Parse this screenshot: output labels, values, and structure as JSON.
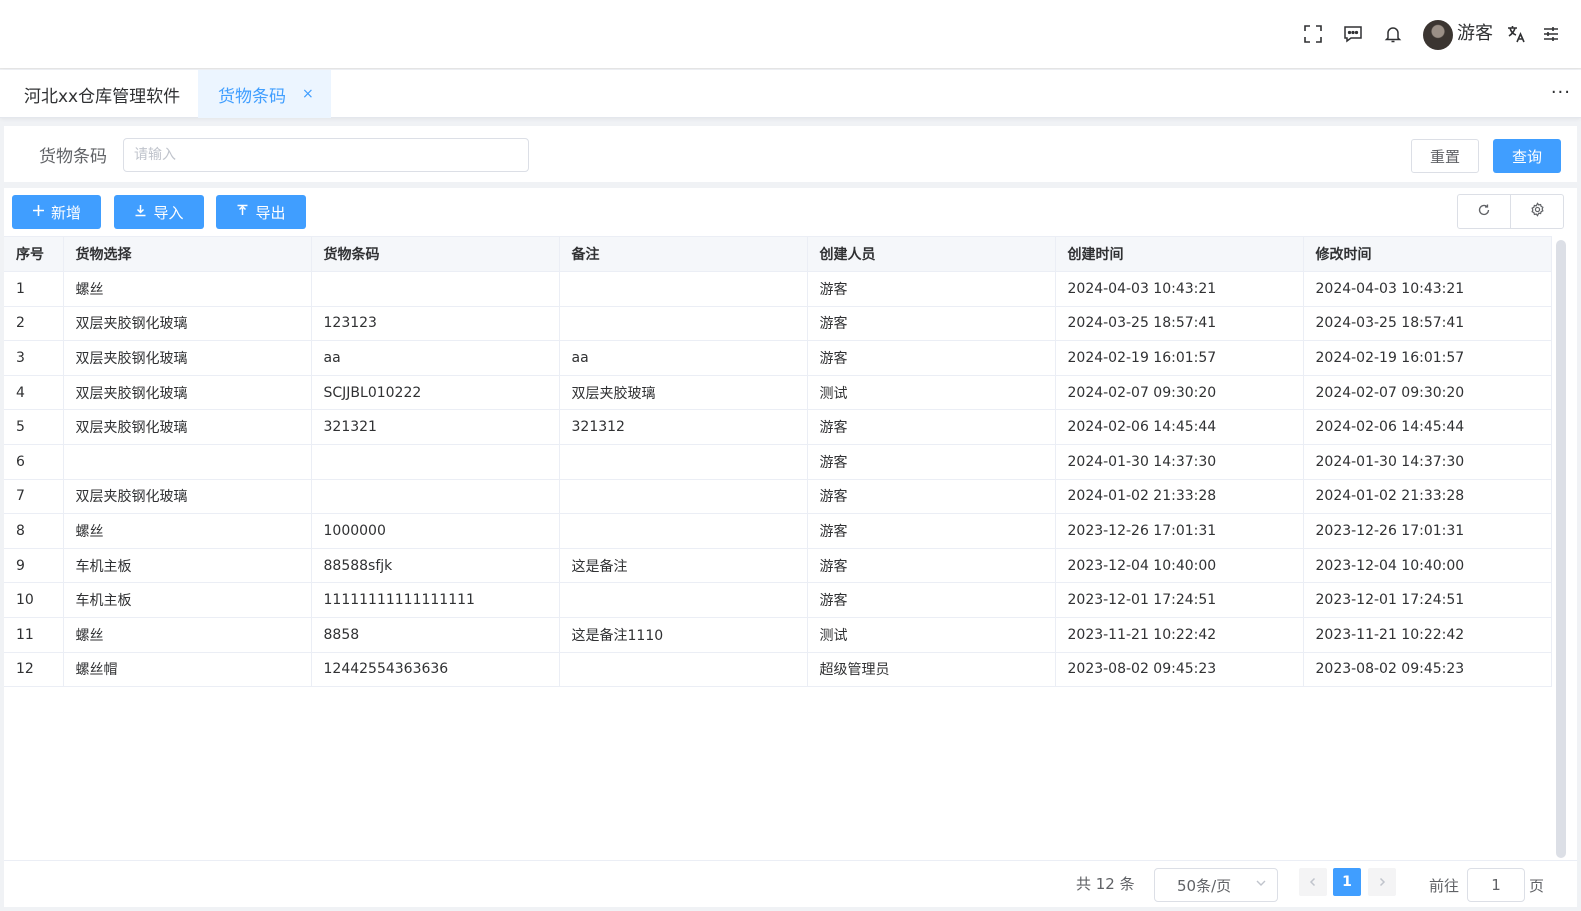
{
  "header": {
    "username": "游客",
    "icons": [
      "fullscreen-icon",
      "message-icon",
      "bell-icon",
      "avatar",
      "translate-icon",
      "settings-sliders-icon"
    ]
  },
  "tabs": {
    "home": "河北xx仓库管理软件",
    "active": "货物条码",
    "close": "×",
    "more": "···"
  },
  "search": {
    "label": "货物条码",
    "placeholder": "请输入",
    "value": "",
    "reset_label": "重置",
    "query_label": "查询"
  },
  "toolbar": {
    "add_label": "新增",
    "import_label": "导入",
    "export_label": "导出"
  },
  "table": {
    "columns": [
      "序号",
      "货物选择",
      "货物条码",
      "备注",
      "创建人员",
      "创建时间",
      "修改时间"
    ],
    "rows": [
      [
        "1",
        "螺丝",
        "",
        "",
        "游客",
        "2024-04-03 10:43:21",
        "2024-04-03 10:43:21"
      ],
      [
        "2",
        "双层夹胶钢化玻璃",
        "123123",
        "",
        "游客",
        "2024-03-25 18:57:41",
        "2024-03-25 18:57:41"
      ],
      [
        "3",
        "双层夹胶钢化玻璃",
        "aa",
        "aa",
        "游客",
        "2024-02-19 16:01:57",
        "2024-02-19 16:01:57"
      ],
      [
        "4",
        "双层夹胶钢化玻璃",
        "SCJJBL010222",
        "双层夹胶玻璃",
        "测试",
        "2024-02-07 09:30:20",
        "2024-02-07 09:30:20"
      ],
      [
        "5",
        "双层夹胶钢化玻璃",
        "321321",
        "321312",
        "游客",
        "2024-02-06 14:45:44",
        "2024-02-06 14:45:44"
      ],
      [
        "6",
        "",
        "",
        "",
        "游客",
        "2024-01-30 14:37:30",
        "2024-01-30 14:37:30"
      ],
      [
        "7",
        "双层夹胶钢化玻璃",
        "",
        "",
        "游客",
        "2024-01-02 21:33:28",
        "2024-01-02 21:33:28"
      ],
      [
        "8",
        "螺丝",
        "1000000",
        "",
        "游客",
        "2023-12-26 17:01:31",
        "2023-12-26 17:01:31"
      ],
      [
        "9",
        "车机主板",
        "88588sfjk",
        "这是备注",
        "游客",
        "2023-12-04 10:40:00",
        "2023-12-04 10:40:00"
      ],
      [
        "10",
        "车机主板",
        "11111111111111111",
        "",
        "游客",
        "2023-12-01 17:24:51",
        "2023-12-01 17:24:51"
      ],
      [
        "11",
        "螺丝",
        "8858",
        "这是备注1110",
        "测试",
        "2023-11-21 10:22:42",
        "2023-11-21 10:22:42"
      ],
      [
        "12",
        "螺丝帽",
        "12442554363636",
        "",
        "超级管理员",
        "2023-08-02 09:45:23",
        "2023-08-02 09:45:23"
      ]
    ]
  },
  "pagination": {
    "total_text": "共 12 条",
    "page_size": "50条/页",
    "current_page": "1",
    "goto_label": "前往",
    "goto_value": "1",
    "page_suffix": "页"
  },
  "colors": {
    "primary": "#409eff",
    "tab_active_bg": "#ecf5ff",
    "header_bg": "#f5f7fa"
  }
}
